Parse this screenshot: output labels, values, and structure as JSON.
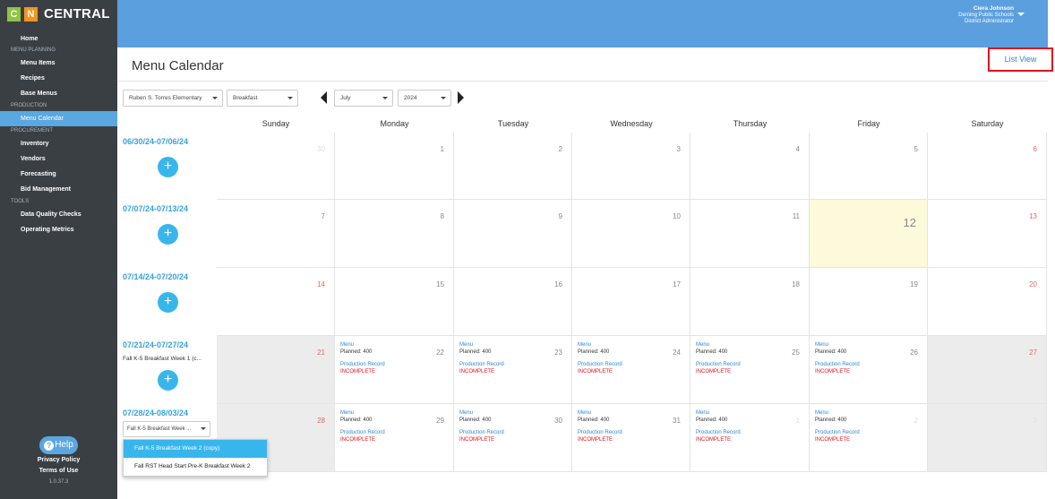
{
  "app": {
    "logo_c": "C",
    "logo_n": "N",
    "name": "CENTRAL"
  },
  "sidebar": {
    "home": "Home",
    "sections": [
      {
        "label": "MENU PLANNING",
        "items": [
          "Menu Items",
          "Recipes",
          "Base Menus"
        ]
      },
      {
        "label": "PRODUCTION",
        "items": [
          "Menu Calendar"
        ]
      },
      {
        "label": "PROCUREMENT",
        "items": [
          "Inventory",
          "Vendors",
          "Forecasting",
          "Bid Management"
        ]
      },
      {
        "label": "TOOLS",
        "items": [
          "Data Quality Checks",
          "Operating Metrics"
        ]
      }
    ],
    "active": "Menu Calendar",
    "help": "Help",
    "privacy": "Privacy Policy",
    "terms": "Terms of Use",
    "version": "1.0.37.3"
  },
  "user": {
    "name": "Ciera Johnson",
    "org": "Deming Public Schools",
    "role": "District Administrator"
  },
  "page": {
    "title": "Menu Calendar",
    "list_view": "List View"
  },
  "filters": {
    "school": "Ruben S. Torres Elementary",
    "meal": "Breakfast",
    "month": "July",
    "year": "2024"
  },
  "days": [
    "Sunday",
    "Monday",
    "Tuesday",
    "Wednesday",
    "Thursday",
    "Friday",
    "Saturday"
  ],
  "weeks": [
    {
      "range": "06/30/24-07/06/24",
      "dates": [
        "30",
        "1",
        "2",
        "3",
        "4",
        "5",
        "6"
      ]
    },
    {
      "range": "07/07/24-07/13/24",
      "dates": [
        "7",
        "8",
        "9",
        "10",
        "11",
        "12",
        "13"
      ]
    },
    {
      "range": "07/14/24-07/20/24",
      "dates": [
        "14",
        "15",
        "16",
        "17",
        "18",
        "19",
        "20"
      ]
    },
    {
      "range": "07/21/24-07/27/24",
      "menu_name": "Fall K-5 Breakfast Week 1 (c...",
      "dates": [
        "21",
        "22",
        "23",
        "24",
        "25",
        "26",
        "27"
      ]
    },
    {
      "range": "07/28/24-08/03/24",
      "dates": [
        "28",
        "29",
        "30",
        "31",
        "1",
        "2",
        "3"
      ]
    }
  ],
  "cell_labels": {
    "menu": "Menu",
    "planned": "Planned: 400",
    "production_record": "Production Record",
    "incomplete": "INCOMPLETE"
  },
  "week_select": {
    "value": "Fall K-5 Breakfast Week ...",
    "options": [
      "Fall K-5 Breakfast Week 2 (copy)",
      "Fall RST Head Start Pre-K Breakfast Week 2"
    ]
  },
  "colors": {
    "accent": "#5b9fdf",
    "link": "#2a88d8",
    "weekend_red": "#e06666",
    "incomplete": "#e0141e",
    "today_bg": "#fdfadb"
  }
}
